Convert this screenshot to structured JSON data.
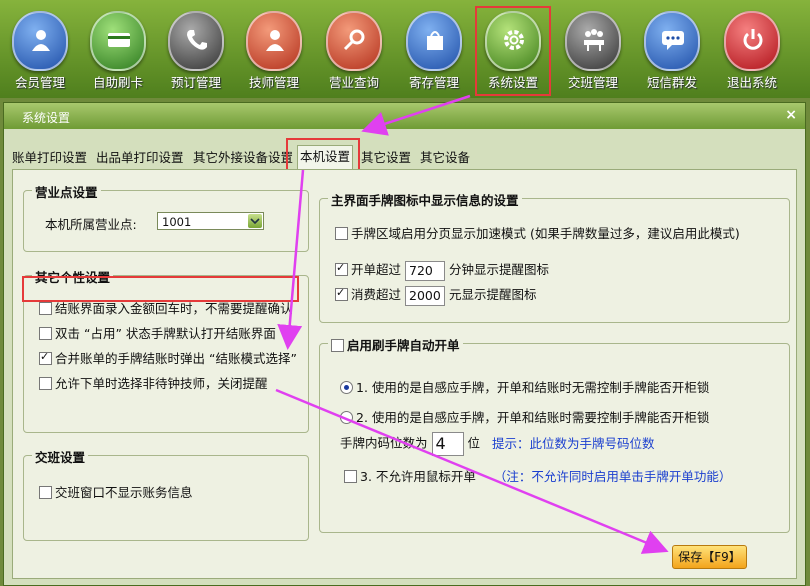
{
  "toolbar": {
    "items": [
      {
        "label": "会员管理",
        "icon": "member-icon",
        "color": "#2a67c9"
      },
      {
        "label": "自助刷卡",
        "icon": "card-icon",
        "color": "#3f8f2e"
      },
      {
        "label": "预订管理",
        "icon": "phone-icon",
        "color": "#4a4a4a"
      },
      {
        "label": "技师管理",
        "icon": "technician-icon",
        "color": "#c8422a"
      },
      {
        "label": "营业查询",
        "icon": "search-icon",
        "color": "#c8422a"
      },
      {
        "label": "寄存管理",
        "icon": "bag-icon",
        "color": "#2a67c9"
      },
      {
        "label": "系统设置",
        "icon": "gear-icon",
        "color": "#5a9a25"
      },
      {
        "label": "交班管理",
        "icon": "meeting-icon",
        "color": "#4a4a4a"
      },
      {
        "label": "短信群发",
        "icon": "message-icon",
        "color": "#2a67c9"
      },
      {
        "label": "退出系统",
        "icon": "power-icon",
        "color": "#c8222a"
      }
    ]
  },
  "dialog": {
    "title": "系统设置",
    "close": "×",
    "tabs": [
      "账单打印设置",
      "出品单打印设置",
      "其它外接设备设置",
      "本机设置",
      "其它设置",
      "其它设备"
    ]
  },
  "outlet": {
    "title": "营业点设置",
    "label": "本机所属营业点:",
    "value": "1001"
  },
  "personal": {
    "title": "其它个性设置",
    "options": [
      {
        "text": "结账界面录入金额回车时，不需要提醒确认",
        "checked": false
      },
      {
        "text": "双击 “占用” 状态手牌默认打开结账界面",
        "checked": false
      },
      {
        "text": "合并账单的手牌结账时弹出 “结账模式选择”",
        "checked": true
      },
      {
        "text": "允许下单时选择非待钟技师，关闭提醒",
        "checked": false
      }
    ]
  },
  "shift": {
    "title": "交班设置",
    "option": "交班窗口不显示账务信息"
  },
  "main_icon": {
    "title": "主界面手牌图标中显示信息的设置",
    "paging": "手牌区域启用分页显示加速模式 (如果手牌数量过多，建议启用此模式)",
    "open_prefix": "开单超过",
    "open_value": "720",
    "open_suffix": "分钟显示提醒图标",
    "spend_prefix": "消费超过",
    "spend_value": "2000",
    "spend_suffix": "元显示提醒图标"
  },
  "auto_open": {
    "title": "启用刷手牌自动开单",
    "option1": "1. 使用的是自感应手牌，开单和结账时无需控制手牌能否开柜锁",
    "option2": "2. 使用的是自感应手牌，开单和结账时需要控制手牌能否开柜锁",
    "digits_label": "手牌内码位数为",
    "digits_value": "4",
    "digits_unit": "位",
    "digits_hint": "提示：此位数为手牌号码位数",
    "mouse_label": "3. 不允许用鼠标开单",
    "mouse_note": "（注：不允许同时启用单击手牌开单功能）"
  },
  "save_label": "保存【F9】",
  "colors": {
    "highlight": "#e53a3a",
    "arrow": "#e040f0",
    "accent": "#6f9b35"
  }
}
